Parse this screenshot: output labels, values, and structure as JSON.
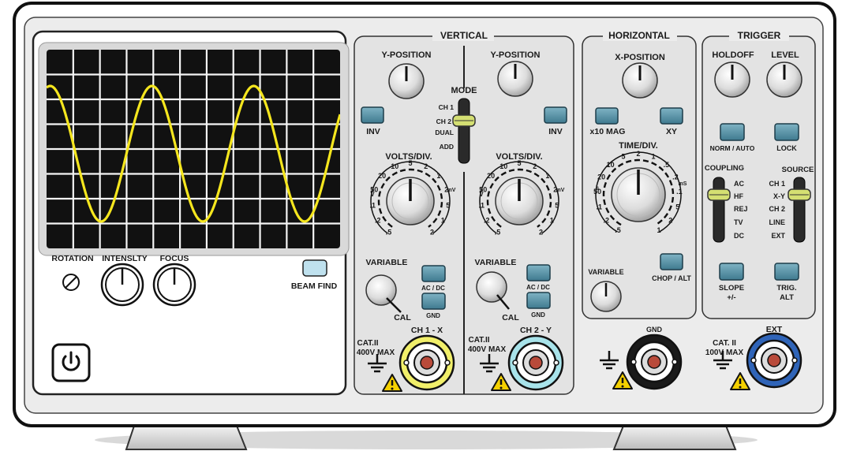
{
  "screen": {
    "trace_color": "#f5e61e",
    "background": "#111111",
    "grid": true
  },
  "left_panel": {
    "rotation": "ROTATION",
    "intensity": "INTENSLTY",
    "focus": "FOCUS",
    "beam_find": "BEAM FIND",
    "power_icon": "power-icon"
  },
  "vertical": {
    "title": "VERTICAL",
    "ypos": "Y-POSITION",
    "mode": {
      "label": "MODE",
      "options": [
        "CH 1",
        "CH 2",
        "DUAL",
        "ADD"
      ],
      "selected": "CH 2"
    },
    "inv": "INV",
    "volts_div": "VOLTS/DIV.",
    "volts_scale": [
      ".5",
      ".2",
      ".1",
      "50",
      "20",
      "10",
      "5",
      "2",
      "1",
      "2",
      "5",
      "1",
      "2"
    ],
    "unit_v": "V",
    "unit_mv": "mV",
    "variable": "VARIABLE",
    "cal": "CAL",
    "acdc": "AC / DC",
    "gnd": "GND",
    "cat": [
      "CAT.II",
      "400V MAX"
    ],
    "ch1": "CH 1 - X",
    "ch2": "CH 2 - Y"
  },
  "horizontal": {
    "title": "HORIZONTAL",
    "xpos": "X-POSITION",
    "x10mag": "x10 MAG",
    "xy": "XY",
    "time_div": "TIME/DIV.",
    "unit_s": "s",
    "unit_ms": "mS",
    "time_scale": [
      ".5",
      ".2",
      ".1",
      "50",
      "20",
      "10",
      "5",
      "2",
      "1",
      ".5",
      ".2",
      ".1",
      "5",
      "2",
      "1"
    ],
    "variable": "VARIABLE",
    "chop_alt": "CHOP / ALT",
    "gnd": "GND"
  },
  "trigger": {
    "title": "TRIGGER",
    "holdoff": "HOLDOFF",
    "level": "LEVEL",
    "norm_auto": "NORM / AUTO",
    "lock": "LOCK",
    "coupling": {
      "label": "COUPLING",
      "options": [
        "AC",
        "HF",
        "REJ",
        "TV",
        "DC"
      ],
      "selected": "HF"
    },
    "source": {
      "label": "SOURCE",
      "options": [
        "CH 1",
        "X-Y",
        "CH 2",
        "LINE",
        "EXT"
      ],
      "selected": "X-Y"
    },
    "slope": [
      "SLOPE",
      "+/-"
    ],
    "trig_alt": [
      "TRIG.",
      "ALT"
    ],
    "ext": "EXT",
    "cat": [
      "CAT. II",
      "100V MAX"
    ]
  },
  "colors": {
    "ch1_ring": "#f1ef6a",
    "ch2_ring": "#a8e3ea",
    "gnd_ring": "#1a1a1a",
    "ext_ring": "#2f64b8",
    "button": "#5d95a8",
    "beam_button": "#bfe1ee",
    "panel": "#e6e6e6",
    "warning": "#f4d000"
  }
}
